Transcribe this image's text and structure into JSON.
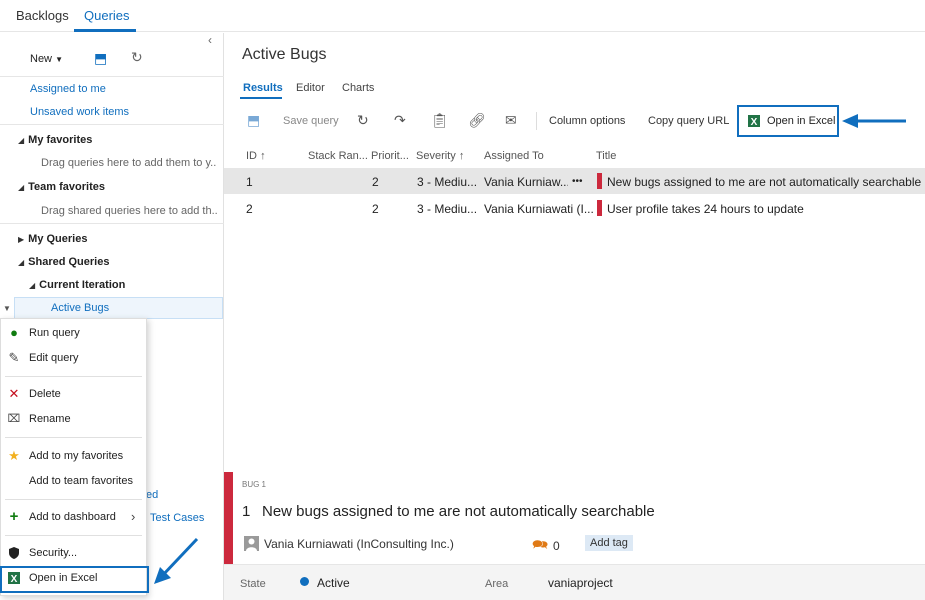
{
  "top_tabs": [
    "Backlogs",
    "Queries"
  ],
  "left": {
    "new_label": "New",
    "links": [
      "Assigned to me",
      "Unsaved work items"
    ],
    "my_favorites": {
      "title": "My favorites",
      "hint": "Drag queries here to add them to y..."
    },
    "team_favorites": {
      "title": "Team favorites",
      "hint": "Drag shared queries here to add th..."
    },
    "my_queries": "My Queries",
    "shared_queries": "Shared Queries",
    "current_iteration": "Current Iteration",
    "selected_query": "Active Bugs",
    "peek_texts": [
      "ed",
      "Test Cases"
    ]
  },
  "context_menu": {
    "items": [
      {
        "label": "Run query",
        "icon": "play-icon"
      },
      {
        "label": "Edit query",
        "icon": "pencil-icon"
      },
      {
        "label": "Delete",
        "icon": "x-icon"
      },
      {
        "label": "Rename",
        "icon": "rename-icon"
      },
      {
        "label": "Add to my favorites",
        "icon": "star-icon"
      },
      {
        "label": "Add to team favorites",
        "icon": ""
      },
      {
        "label": "Add to dashboard",
        "icon": "plus-icon"
      },
      {
        "label": "Security...",
        "icon": "shield-icon"
      },
      {
        "label": "Open in Excel",
        "icon": "excel-icon"
      }
    ]
  },
  "main": {
    "title": "Active Bugs",
    "subtabs": [
      "Results",
      "Editor",
      "Charts"
    ],
    "toolbar": {
      "save_query": "Save query",
      "column_options": "Column options",
      "copy_query_url": "Copy query URL",
      "open_in_excel": "Open in Excel"
    },
    "columns": [
      "ID",
      "Stack Ran...",
      "Priorit...",
      "Severity",
      "Assigned To",
      "Title"
    ],
    "rows": [
      {
        "id": "1",
        "priority": "2",
        "severity": "3 - Mediu...",
        "assigned": "Vania Kurniaw...",
        "more": "•••",
        "title": "New bugs assigned to me are not automatically searchable"
      },
      {
        "id": "2",
        "priority": "2",
        "severity": "3 - Mediu...",
        "assigned": "Vania Kurniawati (I...",
        "more": "",
        "title": "User profile takes 24 hours to update"
      }
    ]
  },
  "detail": {
    "type_label": "BUG 1",
    "id": "1",
    "title": "New bugs assigned to me are not automatically searchable",
    "assigned": "Vania Kurniawati (InConsulting Inc.)",
    "comments": "0",
    "add_tag": "Add tag",
    "state_label": "State",
    "state_value": "Active",
    "area_label": "Area",
    "area_value": "vaniaproject"
  },
  "colors": {
    "accent": "#106ebe",
    "bug_red": "#cc293d",
    "excel_green": "#217346",
    "run_green": "#107c10",
    "delete_red": "#c50f1f",
    "star_yellow": "#f2b01e"
  }
}
